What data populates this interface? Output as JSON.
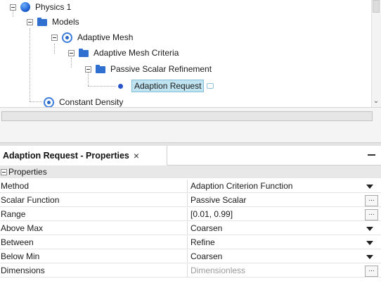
{
  "tree": {
    "items": [
      {
        "label": "Physics 1",
        "icon": "sphere-icon"
      },
      {
        "label": "Models",
        "icon": "folder-icon"
      },
      {
        "label": "Adaptive Mesh",
        "icon": "model-target-icon"
      },
      {
        "label": "Adaptive Mesh Criteria",
        "icon": "folder-icon"
      },
      {
        "label": "Passive Scalar Refinement",
        "icon": "folder-icon"
      },
      {
        "label": "Adaption Request",
        "icon": "dot-icon",
        "selected": true
      },
      {
        "label": "Constant Density",
        "icon": "model-target-icon"
      }
    ]
  },
  "properties_panel": {
    "title": "Adaption Request - Properties",
    "close_glyph": "×",
    "group_label": "Properties",
    "rows": [
      {
        "name": "Method",
        "value": "Adaption Criterion Function",
        "control": "dropdown"
      },
      {
        "name": "Scalar Function",
        "value": "Passive Scalar",
        "control": "ellipsis"
      },
      {
        "name": "Range",
        "value": "[0.01, 0.99]",
        "control": "ellipsis"
      },
      {
        "name": "Above Max",
        "value": "Coarsen",
        "control": "dropdown"
      },
      {
        "name": "Between",
        "value": "Refine",
        "control": "dropdown"
      },
      {
        "name": "Below Min",
        "value": "Coarsen",
        "control": "dropdown"
      },
      {
        "name": "Dimensions",
        "value": "Dimensionless",
        "control": "ellipsis",
        "muted": true
      }
    ],
    "ellipsis_label": "..."
  },
  "colors": {
    "selection": "#bfe3f1",
    "selection_border": "#84bfd8",
    "icon_blue": "#2f6fd0",
    "group_header_bg": "#e8e8e8"
  }
}
